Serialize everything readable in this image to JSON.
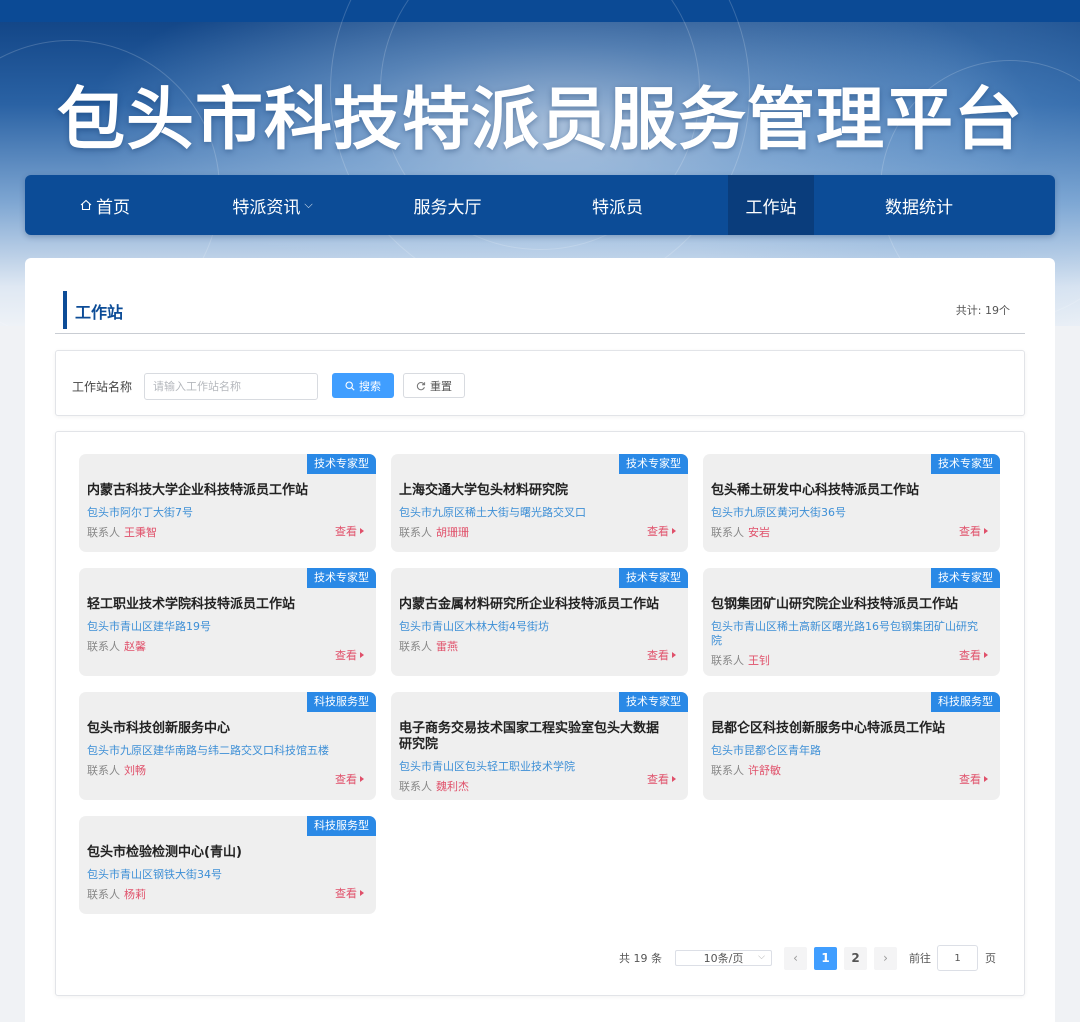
{
  "header": {
    "title": "包头市科技特派员服务管理平台"
  },
  "nav": {
    "items": [
      {
        "label": "首页",
        "icon": "home-icon"
      },
      {
        "label": "特派资讯",
        "has_dropdown": true
      },
      {
        "label": "服务大厅"
      },
      {
        "label": "特派员"
      },
      {
        "label": "工作站",
        "active": true
      },
      {
        "label": "数据统计"
      }
    ]
  },
  "section": {
    "title": "工作站",
    "count_text": "共计: 19个"
  },
  "search": {
    "label": "工作站名称",
    "placeholder": "请输入工作站名称",
    "search_label": "搜索",
    "reset_label": "重置"
  },
  "card_labels": {
    "contact_prefix": "联系人",
    "view_label": "查看"
  },
  "stations": [
    {
      "tag": "技术专家型",
      "name": "内蒙古科技大学企业科技特派员工作站",
      "address": "包头市阿尔丁大街7号",
      "contact": "王秉智"
    },
    {
      "tag": "技术专家型",
      "name": "上海交通大学包头材料研究院",
      "address": "包头市九原区稀土大街与曙光路交叉口",
      "contact": "胡珊珊"
    },
    {
      "tag": "技术专家型",
      "name": "包头稀土研发中心科技特派员工作站",
      "address": "包头市九原区黄河大街36号",
      "contact": "安岩"
    },
    {
      "tag": "技术专家型",
      "name": "轻工职业技术学院科技特派员工作站",
      "address": "包头市青山区建华路19号",
      "contact": "赵馨"
    },
    {
      "tag": "技术专家型",
      "name": "内蒙古金属材料研究所企业科技特派员工作站",
      "address": "包头市青山区木林大街4号街坊",
      "contact": "雷燕"
    },
    {
      "tag": "技术专家型",
      "name": "包钢集团矿山研究院企业科技特派员工作站",
      "address": "包头市青山区稀土高新区曙光路16号包钢集团矿山研究院",
      "contact": "王钊"
    },
    {
      "tag": "科技服务型",
      "name": "包头市科技创新服务中心",
      "address": "包头市九原区建华南路与纬二路交叉口科技馆五楼",
      "contact": "刘畅"
    },
    {
      "tag": "技术专家型",
      "name": "电子商务交易技术国家工程实验室包头大数据研究院",
      "address": "包头市青山区包头轻工职业技术学院",
      "contact": "魏利杰"
    },
    {
      "tag": "科技服务型",
      "name": "昆都仑区科技创新服务中心特派员工作站",
      "address": "包头市昆都仑区青年路",
      "contact": "许舒敏"
    },
    {
      "tag": "科技服务型",
      "name": "包头市检验检测中心(青山)",
      "address": "包头市青山区钢铁大街34号",
      "contact": "杨莉"
    }
  ],
  "pagination": {
    "total_text": "共 19 条",
    "page_size": "10条/页",
    "pages": [
      "1",
      "2"
    ],
    "current_page": "1",
    "goto_label": "前往",
    "goto_value": "1",
    "page_suffix": "页"
  },
  "colors": {
    "nav_bg": "#0c4c97",
    "tag_bg": "#2a89e6",
    "primary": "#409eff",
    "address": "#3d8fd6",
    "contact_name": "#e0506a"
  }
}
